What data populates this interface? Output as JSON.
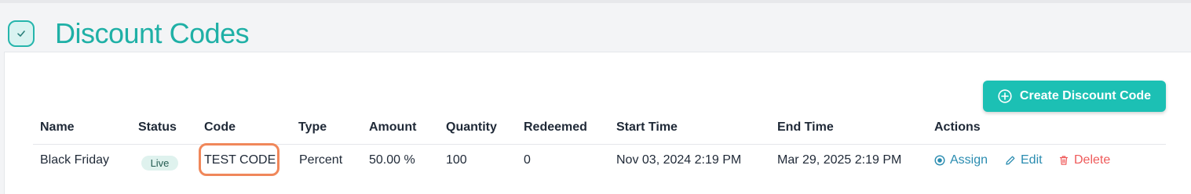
{
  "header": {
    "title": "Discount Codes",
    "icon": "check-circle-icon"
  },
  "toolbar": {
    "create_label": "Create Discount Code",
    "create_icon": "plus-circle-icon"
  },
  "table": {
    "columns": [
      "Name",
      "Status",
      "Code",
      "Type",
      "Amount",
      "Quantity",
      "Redeemed",
      "Start Time",
      "End Time",
      "Actions"
    ],
    "rows": [
      {
        "name": "Black Friday",
        "status": "Live",
        "code": "TEST CODE",
        "type": "Percent",
        "amount": "50.00 %",
        "quantity": "100",
        "redeemed": "0",
        "start_time": "Nov 03, 2024 2:19 PM",
        "end_time": "Mar 29, 2025 2:19 PM",
        "actions": {
          "assign": "Assign",
          "edit": "Edit",
          "delete": "Delete"
        }
      }
    ]
  },
  "colors": {
    "accent": "#1fb0a6",
    "button": "#1cc0b4",
    "link": "#2a8cb0",
    "danger": "#ef5a5a",
    "highlight": "#f0875a"
  }
}
